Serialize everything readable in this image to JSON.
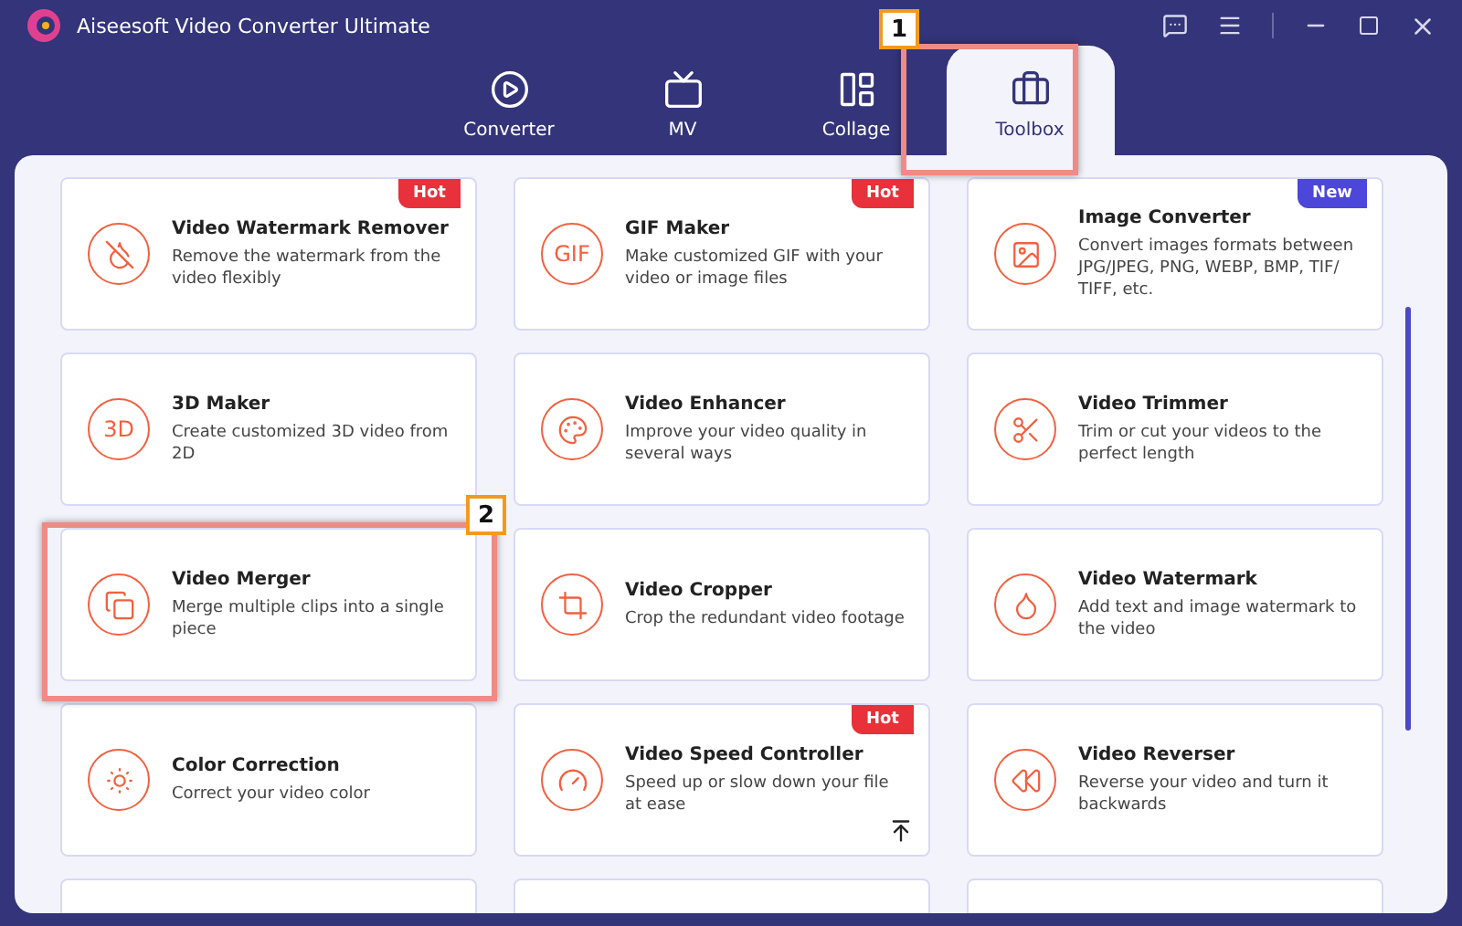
{
  "window": {
    "title": "Aiseesoft Video Converter Ultimate"
  },
  "tabs": [
    {
      "label": "Converter",
      "selected": false
    },
    {
      "label": "MV",
      "selected": false
    },
    {
      "label": "Collage",
      "selected": false
    },
    {
      "label": "Toolbox",
      "selected": true
    }
  ],
  "tools": [
    {
      "kind": "tool",
      "title": "Video Watermark Remover",
      "description": "Remove the watermark from the video flexibly",
      "badge": "Hot",
      "color": "#e8313a"
    },
    {
      "kind": "tool",
      "title": "GIF Maker",
      "description": "Make customized GIF with your video or image files",
      "badge": "Hot",
      "color": "#e8313a",
      "icon_text": "GIF"
    },
    {
      "kind": "tool",
      "title": "Image Converter",
      "description": "Convert images formats between JPG/JPEG, PNG, WEBP, BMP, TIF/ TIFF, etc.",
      "badge": "New",
      "color": "#4c47d8"
    },
    {
      "kind": "tool",
      "title": "3D Maker",
      "description": "Create customized 3D video from 2D",
      "icon_text": "3D"
    },
    {
      "kind": "tool",
      "title": "Video Enhancer",
      "description": "Improve your video quality in several ways"
    },
    {
      "kind": "tool",
      "title": "Video Trimmer",
      "description": "Trim or cut your videos to the perfect length"
    },
    {
      "kind": "tool",
      "title": "Video Merger",
      "description": "Merge multiple clips into a single piece"
    },
    {
      "kind": "tool",
      "title": "Video Cropper",
      "description": "Crop the redundant video footage"
    },
    {
      "kind": "tool",
      "title": "Video Watermark",
      "description": "Add text and image watermark to the video"
    },
    {
      "kind": "tool",
      "title": "Color Correction",
      "description": "Correct your video color"
    },
    {
      "kind": "tool",
      "title": "Video Speed Controller",
      "description": "Speed up or slow down your file at ease",
      "badge": "Hot",
      "color": "#e8313a"
    },
    {
      "kind": "tool",
      "title": "Video Reverser",
      "description": "Reverse your video and turn it backwards"
    },
    {
      "kind": "cut"
    },
    {
      "kind": "cut"
    },
    {
      "kind": "cut"
    }
  ],
  "callouts": [
    {
      "number": "1",
      "kind": "tab"
    },
    {
      "number": "2",
      "kind": "card"
    }
  ]
}
